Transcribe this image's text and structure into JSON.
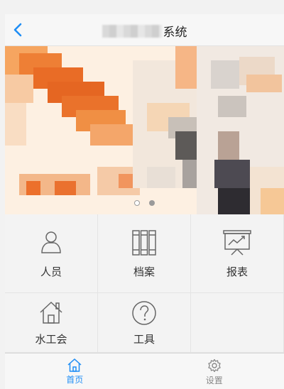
{
  "navbar": {
    "title_visible_suffix": "系统",
    "back_icon": "chevron-left-icon",
    "accent_color": "#1f8ef5"
  },
  "banner": {
    "slide_count": 2,
    "active_slide": 2
  },
  "menu": [
    {
      "label": "人员",
      "icon": "person-icon"
    },
    {
      "label": "档案",
      "icon": "archive-binders-icon"
    },
    {
      "label": "报表",
      "icon": "chart-presentation-icon"
    },
    {
      "label": "水工会",
      "icon": "house-icon"
    },
    {
      "label": "工具",
      "icon": "question-circle-icon"
    }
  ],
  "tabbar": {
    "items": [
      {
        "label": "首页",
        "icon": "home-icon",
        "active": true
      },
      {
        "label": "设置",
        "icon": "gear-icon",
        "active": false
      }
    ]
  }
}
